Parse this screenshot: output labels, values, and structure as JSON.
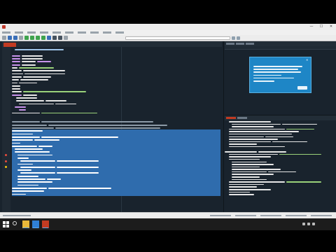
{
  "window": {
    "title": "",
    "controls": {
      "minimize": "—",
      "maximize": "☐",
      "close": "✕"
    }
  },
  "menu": {
    "items": [
      "",
      "",
      "",
      "",
      "",
      "",
      "",
      "",
      "",
      ""
    ]
  },
  "editor": {
    "tab_label": "",
    "lines": [
      {
        "segs": [
          [
            4,
            70,
            "#9fc4e7"
          ]
        ]
      },
      {
        "segs": []
      },
      {
        "segs": [
          [
            0,
            12,
            "#c792ea"
          ],
          [
            14,
            30,
            "#e6e6e6"
          ]
        ]
      },
      {
        "segs": [
          [
            0,
            12,
            "#c792ea"
          ],
          [
            14,
            30,
            "#e6e6e6"
          ]
        ]
      },
      {
        "segs": [
          [
            0,
            12,
            "#c792ea"
          ],
          [
            14,
            20,
            "#e6e6e6"
          ],
          [
            36,
            20,
            "#c792ea"
          ]
        ]
      },
      {
        "segs": [
          [
            0,
            12,
            "#c792ea"
          ],
          [
            14,
            20,
            "#e6e6e6"
          ]
        ]
      },
      {
        "segs": [
          [
            0,
            8,
            "#e6e6e6"
          ],
          [
            10,
            50,
            "#9ad27a"
          ]
        ]
      },
      {
        "segs": [
          [
            0,
            14,
            "#e6e6e6"
          ],
          [
            16,
            60,
            "#e6e6e6"
          ]
        ]
      },
      {
        "segs": [
          [
            0,
            16,
            "#e6e6e6"
          ],
          [
            18,
            58,
            "#e6e6e6"
          ]
        ]
      },
      {
        "segs": [
          [
            0,
            14,
            "#e6e6e6"
          ],
          [
            16,
            40,
            "#e6e6e6"
          ]
        ]
      },
      {
        "segs": [
          [
            0,
            10,
            "#e6e6e6"
          ],
          [
            12,
            40,
            "#e6e6e6"
          ]
        ]
      },
      {
        "segs": [
          [
            0,
            8,
            "#e6e6e6"
          ],
          [
            10,
            26,
            "#e6e6e6"
          ]
        ]
      },
      {
        "segs": [
          [
            0,
            12,
            "#e6e6e6"
          ]
        ]
      },
      {
        "segs": [
          [
            0,
            12,
            "#e6e6e6"
          ]
        ]
      },
      {
        "segs": [
          [
            0,
            14,
            "#e6e6e6"
          ],
          [
            16,
            90,
            "#9ad27a"
          ]
        ]
      },
      {
        "segs": [
          [
            0,
            14,
            "#c792ea"
          ],
          [
            16,
            20,
            "#e6e6e6"
          ]
        ]
      },
      {
        "segs": [
          [
            6,
            30,
            "#e6e6e6"
          ]
        ]
      },
      {
        "segs": [
          [
            6,
            40,
            "#e6e6e6"
          ],
          [
            48,
            30,
            "#e6e6e6"
          ]
        ]
      },
      {
        "segs": [
          [
            10,
            50,
            "#e6e6e6"
          ],
          [
            62,
            30,
            "#e6e6e6"
          ]
        ]
      },
      {
        "segs": [
          [
            4,
            16,
            "#c792ea"
          ]
        ]
      },
      {
        "segs": [
          [
            10,
            10,
            "#c792ea"
          ]
        ]
      },
      {
        "segs": [
          [
            0,
            40,
            "#e6e6e6"
          ],
          [
            42,
            80,
            "#9ad27a"
          ]
        ]
      },
      {
        "segs": []
      },
      {
        "segs": []
      },
      {
        "segs": [
          [
            0,
            40,
            "#8c9aa7"
          ],
          [
            42,
            160,
            "#8c9aa7"
          ]
        ]
      },
      {
        "segs": [
          [
            0,
            50,
            "#8c9aa7"
          ],
          [
            52,
            170,
            "#8c9aa7"
          ]
        ]
      },
      {
        "segs": [
          [
            0,
            60,
            "#8c9aa7"
          ],
          [
            62,
            150,
            "#8c9aa7"
          ]
        ]
      },
      {
        "hl": true,
        "segs": [
          [
            0,
            44,
            "#ffffff"
          ]
        ]
      },
      {
        "hl": true,
        "segs": [
          [
            0,
            30,
            "#ffffff"
          ]
        ]
      },
      {
        "hl": true,
        "segs": [
          [
            0,
            40,
            "#ffffff"
          ],
          [
            42,
            110,
            "#ffffff"
          ]
        ]
      },
      {
        "hl": true,
        "segs": [
          [
            0,
            30,
            "#ffffff"
          ],
          [
            32,
            36,
            "#ffffff"
          ]
        ]
      },
      {
        "hl": true,
        "segs": [
          [
            0,
            12,
            "#ffffff"
          ]
        ]
      },
      {
        "hl": true,
        "segs": [
          [
            0,
            36,
            "#ffffff"
          ],
          [
            38,
            20,
            "#ffffff"
          ]
        ]
      },
      {
        "hl": true,
        "segs": [
          [
            4,
            40,
            "#ffffff"
          ]
        ]
      },
      {
        "hl": true,
        "segs": [
          [
            4,
            50,
            "#ffffff"
          ]
        ]
      },
      {
        "hl": true,
        "marker": "#e74c3c",
        "segs": [
          [
            8,
            50,
            "#ffffff"
          ]
        ]
      },
      {
        "hl": true,
        "segs": [
          [
            8,
            16,
            "#ffffff"
          ]
        ]
      },
      {
        "hl": true,
        "marker": "#e74c3c",
        "segs": [
          [
            12,
            50,
            "#ffffff"
          ],
          [
            64,
            60,
            "#ffffff"
          ]
        ]
      },
      {
        "hl": true,
        "segs": [
          [
            8,
            22,
            "#ffffff"
          ]
        ]
      },
      {
        "hl": true,
        "marker": "#f1c40f",
        "segs": [
          [
            12,
            50,
            "#ffffff"
          ],
          [
            64,
            60,
            "#ffffff"
          ]
        ]
      },
      {
        "hl": true,
        "segs": [
          [
            8,
            20,
            "#ffffff"
          ]
        ]
      },
      {
        "hl": true,
        "segs": [
          [
            12,
            50,
            "#ffffff"
          ],
          [
            64,
            60,
            "#ffffff"
          ]
        ]
      },
      {
        "hl": true,
        "segs": [
          [
            8,
            30,
            "#ffffff"
          ]
        ]
      },
      {
        "hl": true,
        "segs": [
          [
            8,
            40,
            "#ffffff"
          ],
          [
            50,
            20,
            "#ffffff"
          ]
        ]
      },
      {
        "hl": true,
        "segs": [
          [
            8,
            50,
            "#ffffff"
          ]
        ]
      },
      {
        "hl": true,
        "segs": [
          [
            8,
            30,
            "#ffffff"
          ]
        ]
      },
      {
        "hl": true,
        "segs": [
          [
            0,
            50,
            "#ffffff"
          ],
          [
            52,
            90,
            "#ffffff"
          ]
        ]
      },
      {
        "hl": true,
        "segs": [
          [
            0,
            46,
            "#ffffff"
          ]
        ]
      },
      {
        "hl": true,
        "segs": [
          [
            0,
            20,
            "#ffffff"
          ]
        ]
      }
    ]
  },
  "help_pane": {
    "tabs": [
      "",
      "",
      ""
    ],
    "popup": {
      "close": "✕"
    }
  },
  "console": {
    "tabs": [
      "",
      "",
      ""
    ],
    "lines": [
      {
        "segs": [
          [
            6,
            60,
            "#e6e6e6"
          ]
        ]
      },
      {
        "segs": [
          [
            10,
            70,
            "#e6e6e6"
          ],
          [
            82,
            50,
            "#e6e6e6"
          ]
        ]
      },
      {
        "segs": [
          [
            10,
            60,
            "#e6e6e6"
          ]
        ]
      },
      {
        "segs": [
          [
            6,
            80,
            "#e6e6e6"
          ],
          [
            88,
            40,
            "#9ad27a"
          ]
        ]
      },
      {
        "segs": [
          [
            6,
            100,
            "#e6e6e6"
          ]
        ]
      },
      {
        "segs": [
          [
            6,
            90,
            "#e6e6e6"
          ]
        ]
      },
      {
        "segs": [
          [
            6,
            50,
            "#e6e6e6"
          ],
          [
            58,
            40,
            "#e6e6e6"
          ]
        ]
      },
      {
        "segs": [
          [
            6,
            70,
            "#e6e6e6"
          ]
        ]
      },
      {
        "segs": [
          [
            6,
            60,
            "#e6e6e6"
          ],
          [
            68,
            50,
            "#e6e6e6"
          ]
        ]
      },
      {
        "segs": [
          [
            6,
            40,
            "#e6e6e6"
          ]
        ]
      },
      {
        "segs": [
          [
            6,
            80,
            "#e6e6e6"
          ]
        ]
      },
      {
        "segs": []
      },
      {
        "segs": [
          [
            0,
            46,
            "#e6e6e6"
          ],
          [
            48,
            40,
            "#e6e6e6"
          ]
        ]
      },
      {
        "segs": [
          [
            6,
            70,
            "#e6e6e6"
          ],
          [
            78,
            60,
            "#9ad27a"
          ]
        ]
      },
      {
        "segs": [
          [
            6,
            60,
            "#e6e6e6"
          ]
        ]
      },
      {
        "segs": [
          [
            6,
            44,
            "#e6e6e6"
          ]
        ]
      },
      {
        "segs": [
          [
            10,
            50,
            "#e6e6e6"
          ]
        ]
      },
      {
        "segs": [
          [
            10,
            60,
            "#e6e6e6"
          ]
        ]
      },
      {
        "segs": [
          [
            10,
            40,
            "#e6e6e6"
          ]
        ]
      },
      {
        "segs": [
          [
            10,
            70,
            "#e6e6e6"
          ]
        ]
      },
      {
        "segs": [
          [
            10,
            50,
            "#e6e6e6"
          ],
          [
            62,
            40,
            "#e6e6e6"
          ]
        ]
      },
      {
        "segs": [
          [
            10,
            60,
            "#e6e6e6"
          ]
        ]
      },
      {
        "segs": [
          [
            10,
            40,
            "#e6e6e6"
          ]
        ]
      },
      {
        "segs": [
          [
            10,
            50,
            "#e6e6e6"
          ]
        ]
      },
      {
        "segs": [
          [
            6,
            80,
            "#e6e6e6"
          ],
          [
            88,
            50,
            "#9ad27a"
          ]
        ]
      },
      {
        "segs": [
          [
            6,
            50,
            "#e6e6e6"
          ]
        ]
      },
      {
        "segs": [
          [
            6,
            40,
            "#e6e6e6"
          ]
        ]
      },
      {
        "segs": [
          [
            6,
            60,
            "#e6e6e6"
          ]
        ]
      },
      {
        "segs": [
          [
            6,
            30,
            "#e6e6e6"
          ]
        ]
      },
      {
        "segs": [
          [
            6,
            36,
            "#e6e6e6"
          ]
        ]
      }
    ]
  },
  "taskbar": {
    "time": "",
    "date": "",
    "apps": [
      "file-explorer-icon",
      "browser-icon",
      "spyder-icon"
    ]
  },
  "colors": {
    "editor_bg": "#19232d",
    "selection": "#2f6cad",
    "accent": "#c23b22",
    "popup": "#1e86c6"
  }
}
